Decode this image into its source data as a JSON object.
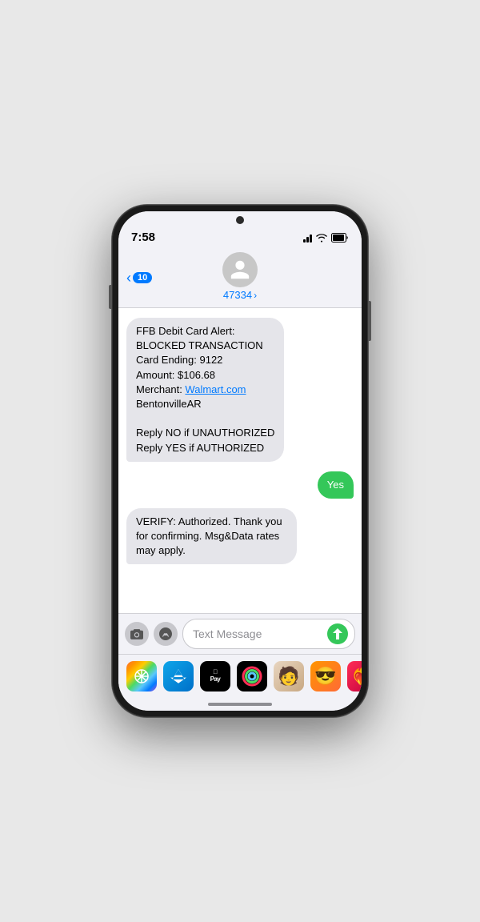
{
  "statusBar": {
    "time": "7:58",
    "batteryIcon": "🔋"
  },
  "header": {
    "backLabel": "10",
    "contactNumber": "47334",
    "chevron": "›"
  },
  "messages": [
    {
      "id": "msg1",
      "type": "incoming",
      "lines": [
        "FFB Debit Card Alert:",
        "BLOCKED TRANSACTION",
        "Card Ending: 9122",
        "Amount: $106.68",
        "Merchant: ",
        "BentonvilleAR",
        "",
        "Reply NO if UNAUTHORIZED",
        "Reply YES if AUTHORIZED"
      ],
      "linkText": "Walmart.com",
      "plainText": "FFB Debit Card Alert:\nBLOCKED TRANSACTION\nCard Ending: 9122\nAmount: $106.68\nMerchant: Walmart.com\nBentonvilleAR\n\nReply NO if UNAUTHORIZED\nReply YES if AUTHORIZED"
    },
    {
      "id": "msg2",
      "type": "outgoing",
      "text": "Yes"
    },
    {
      "id": "msg3",
      "type": "incoming",
      "text": "VERIFY: Authorized. Thank you for confirming. Msg&Data rates may apply."
    }
  ],
  "inputBar": {
    "placeholder": "Text Message",
    "cameraLabel": "camera",
    "appstoreLabel": "appstore"
  },
  "appTray": {
    "apps": [
      {
        "name": "Photos",
        "icon": "🌅"
      },
      {
        "name": "App Store",
        "icon": ""
      },
      {
        "name": "Apple Pay",
        "label": "Pay"
      },
      {
        "name": "Activity",
        "icon": "◎"
      },
      {
        "name": "Memoji",
        "icon": "🧑"
      },
      {
        "name": "Animoji",
        "icon": "😎"
      },
      {
        "name": "Heart",
        "icon": "❤️"
      }
    ]
  }
}
